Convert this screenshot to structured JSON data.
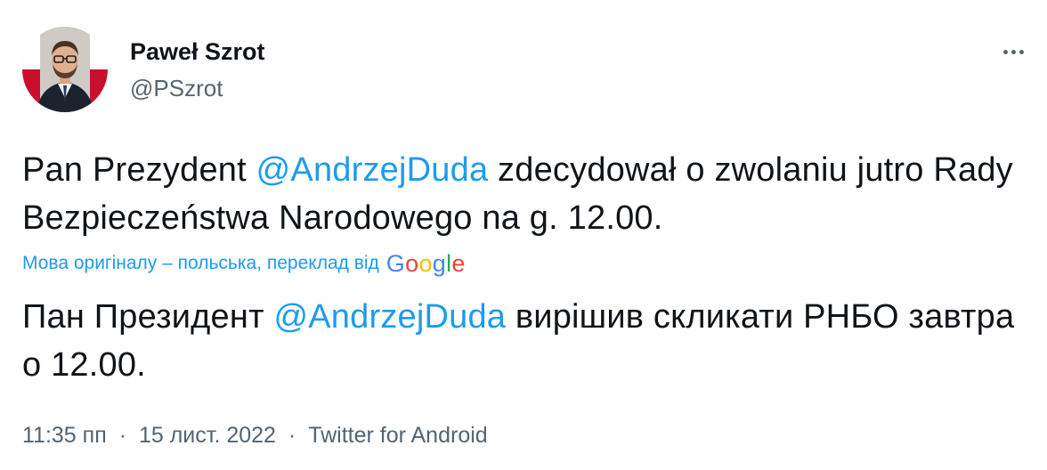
{
  "author": {
    "name": "Paweł Szrot",
    "handle": "@PSzrot"
  },
  "more_icon": "more-horizontal-icon",
  "tweet": {
    "text_before": "Pan Prezydent ",
    "mention": "@AndrzejDuda",
    "text_after": " zdecydował o zwolaniu jutro Rady Bezpieczeństwa Narodowego na g. 12.00."
  },
  "translation": {
    "note": "Мова оригіналу – польська, переклад від",
    "provider": "Google",
    "text_before": "Пан Президент ",
    "mention": "@AndrzejDuda",
    "text_after": " вирішив скликати РНБО завтра о 12.00."
  },
  "meta": {
    "time": "11:35 пп",
    "date": "15 лист. 2022",
    "separator": "·",
    "source": "Twitter for Android"
  },
  "colors": {
    "link": "#1d9bf0",
    "secondary_text": "#536471",
    "primary_text": "#0f1419"
  }
}
